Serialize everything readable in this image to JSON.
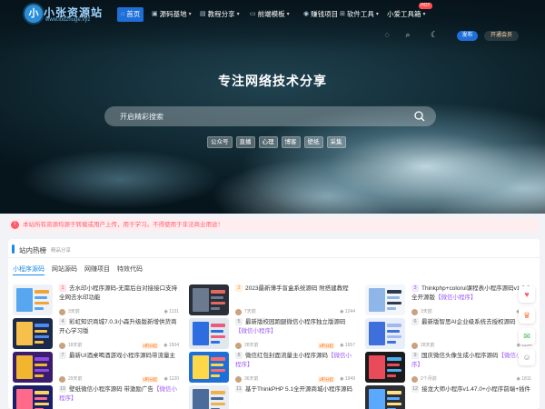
{
  "site": {
    "logo_char": "小",
    "name": "小张资源站",
    "domain": "www.lodzhuge.xyz"
  },
  "nav": [
    {
      "label": "首页",
      "icon": "home-icon",
      "glyph": "⌂",
      "active": true,
      "caret": false
    },
    {
      "label": "源码基地",
      "icon": "code-icon",
      "glyph": "▣",
      "active": false,
      "caret": true
    },
    {
      "label": "教程分享",
      "icon": "book-icon",
      "glyph": "▤",
      "active": false,
      "caret": true
    },
    {
      "label": "前端模板",
      "icon": "monitor-icon",
      "glyph": "▭",
      "active": false,
      "caret": true
    },
    {
      "label": "赚钱项目",
      "icon": "money-icon",
      "glyph": "◉",
      "active": false,
      "caret": false
    },
    {
      "label": "软件工具",
      "icon": "grid-icon",
      "glyph": "⊞",
      "active": false,
      "caret": true
    },
    {
      "label": "小爱工具箱",
      "icon": "",
      "glyph": "",
      "active": false,
      "caret": true
    }
  ],
  "nav_badge": "HOT",
  "header_actions": {
    "publish": "发布",
    "vip": "开通会员"
  },
  "hero": {
    "title": "专注网络技术分享",
    "search_placeholder": "开启精彩搜索",
    "tags": [
      "公众号",
      "直播",
      "心理",
      "博客",
      "壁纸",
      "采集"
    ]
  },
  "notice": {
    "icon": "!",
    "text": "本站所有资源均源于转载或用户上传，用于学习。不得使用于非法商业用途！"
  },
  "section": {
    "title": "站内热榜",
    "subtitle": "精品分享",
    "tabs": [
      "小程序源码",
      "网站源码",
      "网赚项目",
      "特效代码"
    ]
  },
  "cards": [
    {
      "num": "1",
      "title": "去水印小程序源码-无需后台对接接口支持全网去水印功能",
      "highlight": "",
      "time": "3天前",
      "views": "1131",
      "price": ""
    },
    {
      "num": "2",
      "title": "2023最新薄手盲盒系统源码 附搭建教程",
      "highlight": "",
      "time": "7天前",
      "views": "1244",
      "price": ""
    },
    {
      "num": "3",
      "title": "Thinkphp+colorui课程表小程序源码v1.0.0全开源版",
      "highlight": "【微信小程序】",
      "time": "3天前",
      "views": "1218",
      "price": ""
    },
    {
      "num": "4",
      "title": "彩虹知识商城7.0.3小森升级版新增供货商开心学习版",
      "highlight": "",
      "time": "18天前",
      "views": "1504",
      "price": "1积分起"
    },
    {
      "num": "5",
      "title": "最新版校园跑腿微信小程序独立版源码",
      "highlight": "【微信小程序】",
      "time": "28天前",
      "views": "1657",
      "price": "1积分起"
    },
    {
      "num": "6",
      "title": "最新版智思AI企业级系统去授权源码",
      "highlight": "",
      "time": "28天前",
      "views": "1154",
      "price": ""
    },
    {
      "num": "7",
      "title": "最新UI酒桌喝酒游戏小程序源码带流量主",
      "highlight": "",
      "time": "29天前",
      "views": "1120",
      "price": "1积分起"
    },
    {
      "num": "8",
      "title": "微信红包封面流量主小程序源码",
      "highlight": "【微信小程序】",
      "time": "36天前",
      "views": "1949",
      "price": "1积分起"
    },
    {
      "num": "9",
      "title": "国庆微信头像生成小程序源码",
      "highlight": "【微信小程序】",
      "time": "2个月前",
      "views": "1811",
      "price": ""
    },
    {
      "num": "10",
      "title": "壁纸微信小程序源码 带激励广告",
      "highlight": "【微信小程序】",
      "time": "",
      "views": "",
      "price": ""
    },
    {
      "num": "11",
      "title": "基于ThinkPHP 5.1全开源商城小程序源码",
      "highlight": "",
      "time": "",
      "views": "",
      "price": ""
    },
    {
      "num": "12",
      "title": "接龙大师小程序v1.47.0+小程序前端+插件",
      "highlight": "",
      "time": "",
      "views": "",
      "price": ""
    }
  ],
  "side_tools": [
    {
      "name": "side-heart-icon",
      "glyph": "♥",
      "color": "#ff5b6a"
    },
    {
      "name": "side-crown-icon",
      "glyph": "♛",
      "color": "#ff7a3c"
    },
    {
      "name": "side-wechat-icon",
      "glyph": "✉",
      "color": "#35b749"
    },
    {
      "name": "side-user-icon",
      "glyph": "☺",
      "color": "#888888"
    }
  ]
}
